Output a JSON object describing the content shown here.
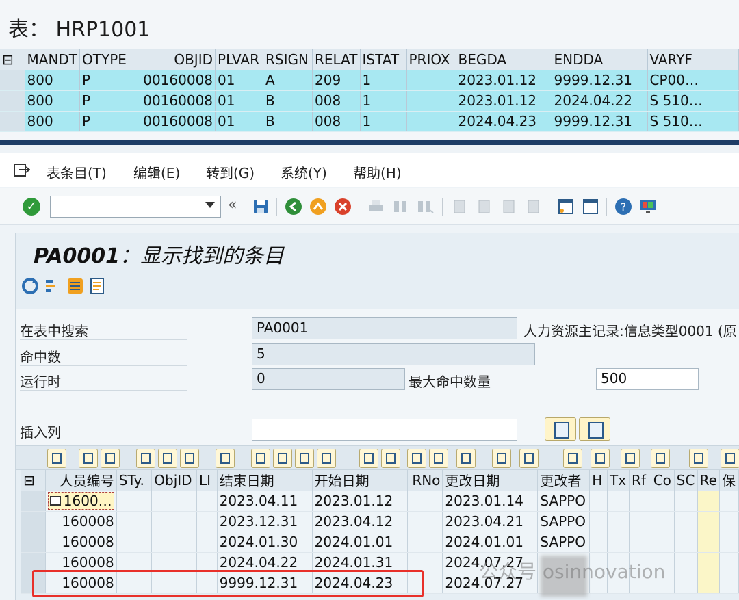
{
  "top_window": {
    "title": "表： HRP1001",
    "columns": [
      "MANDT",
      "OTYPE",
      "OBJID",
      "PLVAR",
      "RSIGN",
      "RELAT",
      "ISTAT",
      "PRIOX",
      "BEGDA",
      "ENDDA",
      "VARYF"
    ],
    "rows": [
      [
        "800",
        "P",
        "00160008",
        "01",
        "A",
        "209",
        "1",
        "",
        "2023.01.12",
        "9999.12.31",
        "CP00…"
      ],
      [
        "800",
        "P",
        "00160008",
        "01",
        "B",
        "008",
        "1",
        "",
        "2023.01.12",
        "2024.04.22",
        "S 510…"
      ],
      [
        "800",
        "P",
        "00160008",
        "01",
        "B",
        "008",
        "1",
        "",
        "2024.04.23",
        "9999.12.31",
        "S 510…"
      ]
    ]
  },
  "menu": {
    "items": [
      "表条目(T)",
      "编辑(E)",
      "转到(G)",
      "系统(Y)",
      "帮助(H)"
    ]
  },
  "toolbar": {
    "command_value": "",
    "back_glyph": "«"
  },
  "panel": {
    "title_code": "PA0001",
    "title_text": "：显示找到的条目"
  },
  "form": {
    "search_label": "在表中搜索",
    "search_value": "PA0001",
    "search_desc": "人力资源主记录:信息类型0001 (原",
    "hits_label": "命中数",
    "hits_value": "5",
    "runtime_label": "运行时",
    "runtime_value": "0",
    "max_hits_label": "最大命中数量",
    "max_hits_value": "500",
    "insert_col_label": "插入列",
    "insert_col_value": ""
  },
  "grid": {
    "columns": [
      "人员编号",
      "STy.",
      "ObjID",
      "LI",
      "结束日期",
      "开始日期",
      "RNo",
      "更改日期",
      "更改者",
      "H",
      "Tx",
      "Rf",
      "Co",
      "SC",
      "Re",
      "保"
    ],
    "first_cell": "1600…",
    "rows": [
      [
        "160008",
        "",
        "",
        "",
        "2023.04.11",
        "2023.01.12",
        "",
        "2023.01.14",
        "SAPPO",
        "",
        "",
        "",
        "",
        "",
        "",
        ""
      ],
      [
        "160008",
        "",
        "",
        "",
        "2023.12.31",
        "2023.04.12",
        "",
        "2023.04.21",
        "SAPPO",
        "",
        "",
        "",
        "",
        "",
        "",
        ""
      ],
      [
        "160008",
        "",
        "",
        "",
        "2024.01.30",
        "2024.01.01",
        "",
        "2024.01.01",
        "SAPPO",
        "",
        "",
        "",
        "",
        "",
        "",
        ""
      ],
      [
        "160008",
        "",
        "",
        "",
        "2024.04.22",
        "2024.01.31",
        "",
        "2024.07.27",
        "",
        "",
        "",
        "",
        "",
        "",
        "",
        ""
      ],
      [
        "160008",
        "",
        "",
        "",
        "9999.12.31",
        "2024.04.23",
        "",
        "2024.07.27",
        "",
        "",
        "",
        "",
        "",
        "",
        "",
        ""
      ]
    ]
  },
  "watermark": "公众号 osinnovation",
  "colors": {
    "selected_row": "#a8e8f2",
    "highlight_box": "#e8302a",
    "title_bar": "#1e3d66"
  }
}
